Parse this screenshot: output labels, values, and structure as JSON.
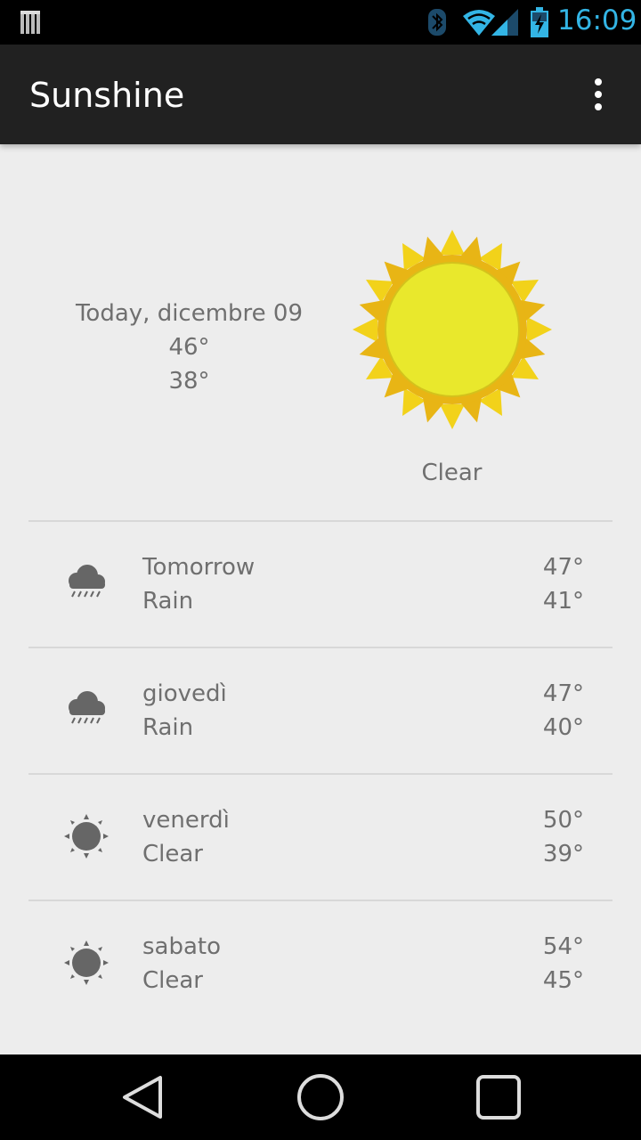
{
  "status_bar": {
    "time": "16:09",
    "accent_color": "#33b5e5",
    "icons": [
      "notification-icon",
      "bluetooth-icon",
      "wifi-icon",
      "signal-icon",
      "battery-charging-icon"
    ]
  },
  "action_bar": {
    "title": "Sunshine",
    "menu_icon": "overflow-menu-icon"
  },
  "today": {
    "date": "Today, dicembre 09",
    "high": "46°",
    "low": "38°",
    "condition": "Clear",
    "icon": "sun-art-icon"
  },
  "forecast": [
    {
      "day": "Tomorrow",
      "description": "Rain",
      "high": "47°",
      "low": "41°",
      "icon": "rain-icon"
    },
    {
      "day": "giovedì",
      "description": "Rain",
      "high": "47°",
      "low": "40°",
      "icon": "rain-icon"
    },
    {
      "day": "venerdì",
      "description": "Clear",
      "high": "50°",
      "low": "39°",
      "icon": "clear-icon"
    },
    {
      "day": "sabato",
      "description": "Clear",
      "high": "54°",
      "low": "45°",
      "icon": "clear-icon"
    }
  ],
  "nav_bar": {
    "buttons": [
      "back-icon",
      "home-icon",
      "recents-icon"
    ]
  }
}
